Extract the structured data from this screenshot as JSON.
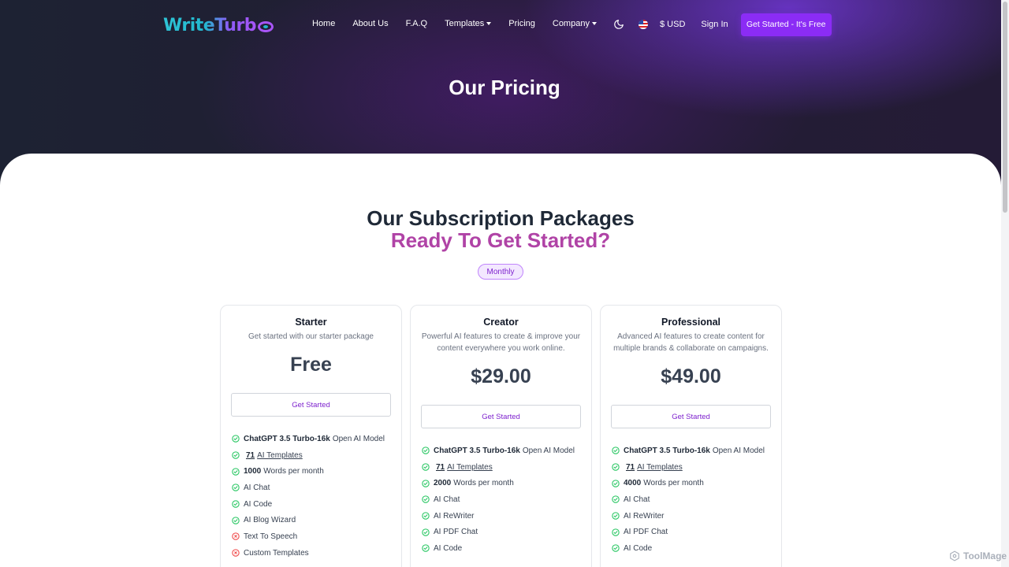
{
  "header": {
    "logo_text": "WriteTurb",
    "nav": [
      {
        "label": "Home"
      },
      {
        "label": "About Us"
      },
      {
        "label": "F.A.Q"
      },
      {
        "label": "Templates",
        "has_dropdown": true
      },
      {
        "label": "Pricing"
      },
      {
        "label": "Company",
        "has_dropdown": true
      }
    ],
    "currency": "$ USD",
    "sign_in": "Sign In",
    "cta": "Get Started - It's Free"
  },
  "hero": {
    "title": "Our Pricing"
  },
  "section": {
    "title": "Our Subscription Packages",
    "subtitle": "Ready To Get Started?",
    "billing_period": "Monthly"
  },
  "plans": [
    {
      "name": "Starter",
      "description": "Get started with our starter package",
      "price": "Free",
      "button": "Get Started",
      "features": [
        {
          "bold": "ChatGPT 3.5 Turbo-16k",
          "text": "Open AI Model",
          "included": true
        },
        {
          "bold": "71",
          "text": "AI Templates",
          "included": true,
          "link": true
        },
        {
          "bold": "1000",
          "text": "Words per month",
          "included": true
        },
        {
          "bold": "",
          "text": "AI Chat",
          "included": true
        },
        {
          "bold": "",
          "text": "AI Code",
          "included": true
        },
        {
          "bold": "",
          "text": "AI Blog Wizard",
          "included": true
        },
        {
          "bold": "",
          "text": "Text To Speech",
          "included": false
        },
        {
          "bold": "",
          "text": "Custom Templates",
          "included": false
        }
      ]
    },
    {
      "name": "Creator",
      "description": "Powerful AI features to create & improve your content everywhere you work online.",
      "price": "$29.00",
      "button": "Get Started",
      "features": [
        {
          "bold": "ChatGPT 3.5 Turbo-16k",
          "text": "Open AI Model",
          "included": true
        },
        {
          "bold": "71",
          "text": "AI Templates",
          "included": true,
          "link": true
        },
        {
          "bold": "2000",
          "text": "Words per month",
          "included": true
        },
        {
          "bold": "",
          "text": "AI Chat",
          "included": true
        },
        {
          "bold": "",
          "text": "AI ReWriter",
          "included": true
        },
        {
          "bold": "",
          "text": "AI PDF Chat",
          "included": true
        },
        {
          "bold": "",
          "text": "AI Code",
          "included": true
        }
      ]
    },
    {
      "name": "Professional",
      "description": "Advanced AI features to create content for multiple brands & collaborate on campaigns.",
      "price": "$49.00",
      "button": "Get Started",
      "features": [
        {
          "bold": "ChatGPT 3.5 Turbo-16k",
          "text": "Open AI Model",
          "included": true
        },
        {
          "bold": "71",
          "text": "AI Templates",
          "included": true,
          "link": true
        },
        {
          "bold": "4000",
          "text": "Words per month",
          "included": true
        },
        {
          "bold": "",
          "text": "AI Chat",
          "included": true
        },
        {
          "bold": "",
          "text": "AI ReWriter",
          "included": true
        },
        {
          "bold": "",
          "text": "AI PDF Chat",
          "included": true
        },
        {
          "bold": "",
          "text": "AI Code",
          "included": true
        }
      ]
    }
  ],
  "watermark": "ToolMage",
  "colors": {
    "accent": "#8b2cf5",
    "subtitle": "#b043a6",
    "included": "#22c55e",
    "excluded": "#ef4444"
  }
}
